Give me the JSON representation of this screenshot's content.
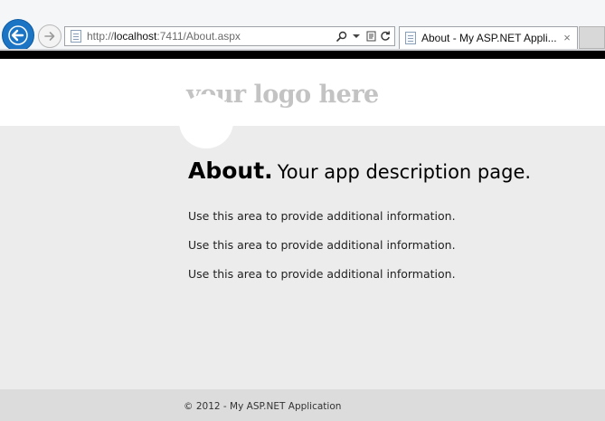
{
  "browser": {
    "url_prefix": "http://",
    "url_host": "localhost",
    "url_rest": ":7411/About.aspx",
    "tab_title": "About - My ASP.NET Appli...",
    "tab_close": "×",
    "icons": [
      "back-arrow-icon",
      "forward-arrow-icon",
      "page-icon",
      "search-icon",
      "dropdown-icon",
      "compatibility-view-icon",
      "refresh-icon",
      "close-icon"
    ]
  },
  "header": {
    "logo": "your logo here"
  },
  "main": {
    "title": "About.",
    "subtitle": "Your app description page.",
    "paragraphs": [
      "Use this area to provide additional information.",
      "Use this area to provide additional information.",
      "Use this area to provide additional information."
    ]
  },
  "footer": {
    "copyright": "© 2012 - My ASP.NET Application"
  },
  "colors": {
    "page_background": "#ececec",
    "header_background": "#ffffff",
    "footer_background": "#dcdcdc",
    "logo_color": "#c3c3c3",
    "back_button": "#1c75c4"
  }
}
